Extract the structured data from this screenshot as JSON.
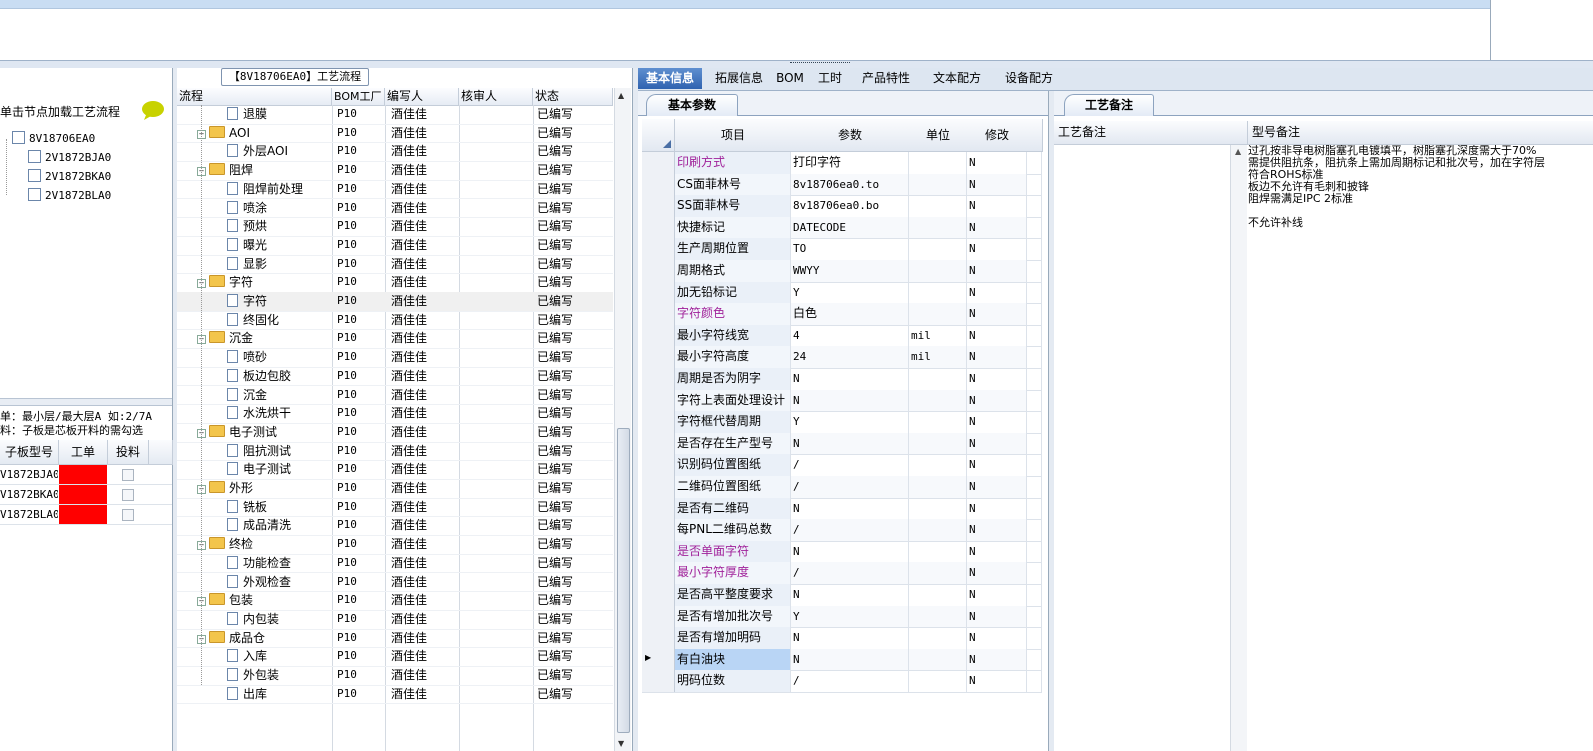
{
  "left": {
    "hint": "单击节点加载工艺流程",
    "tree": {
      "root": "8V18706EA0",
      "children": [
        "2V1872BJA0",
        "2V1872BKA0",
        "2V1872BLA0"
      ]
    },
    "note1": "单：最小层/最大层A 如:2/7A",
    "note2": "料：子板是芯板开料的需勾选",
    "grid": {
      "headers": [
        "子板型号",
        "工单",
        "投料"
      ],
      "rows": [
        "V1872BJA0",
        "V1872BKA0",
        "V1872BLA0"
      ]
    },
    "colors": {
      "order_cell": "#ff0000"
    }
  },
  "flow": {
    "title": "【8V18706EA0】工艺流程",
    "headers": [
      "流程",
      "BOM工厂",
      "编写人",
      "核审人",
      "状态"
    ],
    "rows": [
      {
        "name": "退膜",
        "level": 1,
        "type": "doc",
        "factory": "P10",
        "writer": "酒佳佳",
        "status": "已编写"
      },
      {
        "name": "AOI",
        "level": 0,
        "type": "folder",
        "factory": "P10",
        "writer": "酒佳佳",
        "status": "已编写"
      },
      {
        "name": "外层AOI",
        "level": 1,
        "type": "doc",
        "factory": "P10",
        "writer": "酒佳佳",
        "status": "已编写"
      },
      {
        "name": "阻焊",
        "level": 0,
        "type": "folder",
        "factory": "P10",
        "writer": "酒佳佳",
        "status": "已编写"
      },
      {
        "name": "阻焊前处理",
        "level": 1,
        "type": "doc",
        "factory": "P10",
        "writer": "酒佳佳",
        "status": "已编写"
      },
      {
        "name": "喷涂",
        "level": 1,
        "type": "doc",
        "factory": "P10",
        "writer": "酒佳佳",
        "status": "已编写"
      },
      {
        "name": "预烘",
        "level": 1,
        "type": "doc",
        "factory": "P10",
        "writer": "酒佳佳",
        "status": "已编写"
      },
      {
        "name": "曝光",
        "level": 1,
        "type": "doc",
        "factory": "P10",
        "writer": "酒佳佳",
        "status": "已编写"
      },
      {
        "name": "显影",
        "level": 1,
        "type": "doc",
        "factory": "P10",
        "writer": "酒佳佳",
        "status": "已编写"
      },
      {
        "name": "字符",
        "level": 0,
        "type": "folder",
        "factory": "P10",
        "writer": "酒佳佳",
        "status": "已编写"
      },
      {
        "name": "字符",
        "level": 1,
        "type": "doc",
        "factory": "P10",
        "writer": "酒佳佳",
        "status": "已编写",
        "selected": true
      },
      {
        "name": "终固化",
        "level": 1,
        "type": "doc",
        "factory": "P10",
        "writer": "酒佳佳",
        "status": "已编写"
      },
      {
        "name": "沉金",
        "level": 0,
        "type": "folder",
        "factory": "P10",
        "writer": "酒佳佳",
        "status": "已编写"
      },
      {
        "name": "喷砂",
        "level": 1,
        "type": "doc",
        "factory": "P10",
        "writer": "酒佳佳",
        "status": "已编写"
      },
      {
        "name": "板边包胶",
        "level": 1,
        "type": "doc",
        "factory": "P10",
        "writer": "酒佳佳",
        "status": "已编写"
      },
      {
        "name": "沉金",
        "level": 1,
        "type": "doc",
        "factory": "P10",
        "writer": "酒佳佳",
        "status": "已编写"
      },
      {
        "name": "水洗烘干",
        "level": 1,
        "type": "doc",
        "factory": "P10",
        "writer": "酒佳佳",
        "status": "已编写"
      },
      {
        "name": "电子测试",
        "level": 0,
        "type": "folder",
        "factory": "P10",
        "writer": "酒佳佳",
        "status": "已编写"
      },
      {
        "name": "阻抗测试",
        "level": 1,
        "type": "doc",
        "factory": "P10",
        "writer": "酒佳佳",
        "status": "已编写"
      },
      {
        "name": "电子测试",
        "level": 1,
        "type": "doc",
        "factory": "P10",
        "writer": "酒佳佳",
        "status": "已编写"
      },
      {
        "name": "外形",
        "level": 0,
        "type": "folder",
        "factory": "P10",
        "writer": "酒佳佳",
        "status": "已编写"
      },
      {
        "name": "铣板",
        "level": 1,
        "type": "doc",
        "factory": "P10",
        "writer": "酒佳佳",
        "status": "已编写"
      },
      {
        "name": "成品清洗",
        "level": 1,
        "type": "doc",
        "factory": "P10",
        "writer": "酒佳佳",
        "status": "已编写"
      },
      {
        "name": "终检",
        "level": 0,
        "type": "folder",
        "factory": "P10",
        "writer": "酒佳佳",
        "status": "已编写"
      },
      {
        "name": "功能检查",
        "level": 1,
        "type": "doc",
        "factory": "P10",
        "writer": "酒佳佳",
        "status": "已编写"
      },
      {
        "name": "外观检查",
        "level": 1,
        "type": "doc",
        "factory": "P10",
        "writer": "酒佳佳",
        "status": "已编写"
      },
      {
        "name": "包装",
        "level": 0,
        "type": "folder",
        "factory": "P10",
        "writer": "酒佳佳",
        "status": "已编写"
      },
      {
        "name": "内包装",
        "level": 1,
        "type": "doc",
        "factory": "P10",
        "writer": "酒佳佳",
        "status": "已编写"
      },
      {
        "name": "成品仓",
        "level": 0,
        "type": "folder",
        "factory": "P10",
        "writer": "酒佳佳",
        "status": "已编写"
      },
      {
        "name": "入库",
        "level": 1,
        "type": "doc",
        "factory": "P10",
        "writer": "酒佳佳",
        "status": "已编写"
      },
      {
        "name": "外包装",
        "level": 1,
        "type": "doc",
        "factory": "P10",
        "writer": "酒佳佳",
        "status": "已编写"
      },
      {
        "name": "出库",
        "level": 1,
        "type": "doc",
        "factory": "P10",
        "writer": "酒佳佳",
        "status": "已编写"
      }
    ]
  },
  "tabs": [
    "基本信息",
    "拓展信息",
    "BOM",
    "工时",
    "产品特性",
    "文本配方",
    "设备配方"
  ],
  "params": {
    "tab": "基本参数",
    "headers": [
      "项目",
      "参数",
      "单位",
      "修改"
    ],
    "rows": [
      {
        "item": "印刷方式",
        "value": "打印字符",
        "unit": "",
        "mod": "N",
        "purple": true
      },
      {
        "item": "CS面菲林号",
        "value": "8v18706ea0.to",
        "unit": "",
        "mod": "N"
      },
      {
        "item": "SS面菲林号",
        "value": "8v18706ea0.bo",
        "unit": "",
        "mod": "N"
      },
      {
        "item": "快捷标记",
        "value": "DATECODE",
        "unit": "",
        "mod": "N"
      },
      {
        "item": "生产周期位置",
        "value": "TO",
        "unit": "",
        "mod": "N"
      },
      {
        "item": "周期格式",
        "value": "WWYY",
        "unit": "",
        "mod": "N"
      },
      {
        "item": "加无铅标记",
        "value": "Y",
        "unit": "",
        "mod": "N"
      },
      {
        "item": "字符颜色",
        "value": "白色",
        "unit": "",
        "mod": "N",
        "purple": true
      },
      {
        "item": "最小字符线宽",
        "value": "4",
        "unit": "mil",
        "mod": "N"
      },
      {
        "item": "最小字符高度",
        "value": "24",
        "unit": "mil",
        "mod": "N"
      },
      {
        "item": "周期是否为阴字",
        "value": "N",
        "unit": "",
        "mod": "N"
      },
      {
        "item": "字符上表面处理设计",
        "value": "N",
        "unit": "",
        "mod": "N"
      },
      {
        "item": "字符框代替周期",
        "value": "Y",
        "unit": "",
        "mod": "N"
      },
      {
        "item": "是否存在生产型号",
        "value": "N",
        "unit": "",
        "mod": "N"
      },
      {
        "item": "识别码位置图纸",
        "value": "/",
        "unit": "",
        "mod": "N"
      },
      {
        "item": "二维码位置图纸",
        "value": "/",
        "unit": "",
        "mod": "N"
      },
      {
        "item": "是否有二维码",
        "value": "N",
        "unit": "",
        "mod": "N"
      },
      {
        "item": "每PNL二维码总数",
        "value": "/",
        "unit": "",
        "mod": "N"
      },
      {
        "item": "是否单面字符",
        "value": "N",
        "unit": "",
        "mod": "N",
        "purple": true
      },
      {
        "item": "最小字符厚度",
        "value": "/",
        "unit": "",
        "mod": "N",
        "purple": true
      },
      {
        "item": "是否高平整度要求",
        "value": "N",
        "unit": "",
        "mod": "N"
      },
      {
        "item": "是否有增加批次号",
        "value": "Y",
        "unit": "",
        "mod": "N"
      },
      {
        "item": "是否有增加明码",
        "value": "N",
        "unit": "",
        "mod": "N"
      },
      {
        "item": "有白油块",
        "value": "N",
        "unit": "",
        "mod": "N",
        "current": true
      },
      {
        "item": "明码位数",
        "value": "/",
        "unit": "",
        "mod": "N"
      }
    ]
  },
  "remarks": {
    "tab": "工艺备注",
    "headers": [
      "工艺备注",
      "型号备注"
    ],
    "lines": [
      "过孔按非导电树脂塞孔电镀填平，树脂塞孔深度需大于70%",
      "需提供阻抗条，阻抗条上需加周期标记和批次号，加在字符层",
      "符合ROHS标准",
      "板边不允许有毛刺和披锋",
      "阻焊需满足IPC 2标准",
      "",
      "不允许补线"
    ]
  },
  "colors": {
    "accent_tab": "#2f63b0",
    "purple_label": "#a0219a",
    "row_highlight": "#b9d5f5"
  }
}
